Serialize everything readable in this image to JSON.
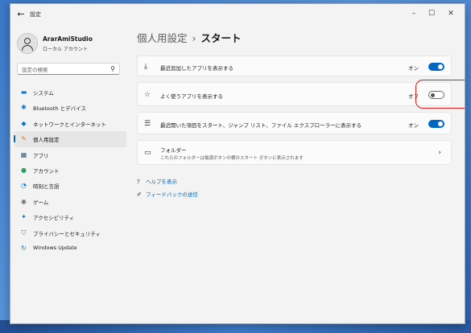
{
  "window": {
    "title": "設定",
    "back_glyph": "←",
    "min_glyph": "–",
    "max_glyph": "☐",
    "close_glyph": "✕"
  },
  "user": {
    "name": "ArarAmiStudio",
    "account_type": "ローカル アカウント"
  },
  "search": {
    "placeholder": "設定の検索",
    "icon": "search-icon",
    "glyph": "⚲"
  },
  "sidebar": {
    "items": [
      {
        "label": "システム",
        "icon": "monitor-icon",
        "glyph": "▬",
        "color": "#0078d4"
      },
      {
        "label": "Bluetooth とデバイス",
        "icon": "bluetooth-icon",
        "glyph": "✱",
        "color": "#0078d4"
      },
      {
        "label": "ネットワークとインターネット",
        "icon": "network-icon",
        "glyph": "◆",
        "color": "#0078d4"
      },
      {
        "label": "個人用設定",
        "icon": "brush-icon",
        "glyph": "✎",
        "color": "#d47a18",
        "active": true
      },
      {
        "label": "アプリ",
        "icon": "apps-icon",
        "glyph": "▦",
        "color": "#3c5a7a"
      },
      {
        "label": "アカウント",
        "icon": "account-icon",
        "glyph": "●",
        "color": "#2aa05a"
      },
      {
        "label": "時刻と言語",
        "icon": "globe-clock-icon",
        "glyph": "◔",
        "color": "#0078d4"
      },
      {
        "label": "ゲーム",
        "icon": "game-controller-icon",
        "glyph": "◉",
        "color": "#6b6b6b"
      },
      {
        "label": "アクセシビリティ",
        "icon": "accessibility-icon",
        "glyph": "✦",
        "color": "#0078d4"
      },
      {
        "label": "プライバシーとセキュリティ",
        "icon": "shield-icon",
        "glyph": "⛉",
        "color": "#6b6b6b"
      },
      {
        "label": "Windows Update",
        "icon": "update-icon",
        "glyph": "↻",
        "color": "#0078d4"
      }
    ]
  },
  "main": {
    "breadcrumb_parent": "個人用設定",
    "breadcrumb_sep": "›",
    "breadcrumb_current": "スタート",
    "settings": [
      {
        "label": "最近追加したアプリを表示する",
        "icon": "download-icon",
        "glyph": "⤓",
        "state": "オン",
        "on": true
      },
      {
        "label": "よく使うアプリを表示する",
        "icon": "star-icon",
        "glyph": "☆",
        "state": "オフ",
        "on": false
      },
      {
        "label": "最近開いた項目をスタート、ジャンプ リスト、ファイル エクスプローラーに表示する",
        "icon": "list-icon",
        "glyph": "☰",
        "state": "オン",
        "on": true
      }
    ],
    "folders": {
      "title": "フォルダー",
      "subtitle": "これらのフォルダーは電源ボタンの横のスタート ボタンに表示されます",
      "icon": "folder-icon",
      "glyph": "▭",
      "chevron": "›"
    },
    "links": [
      {
        "label": "ヘルプを表示",
        "icon": "help-icon",
        "glyph": "?"
      },
      {
        "label": "フィードバックの送信",
        "icon": "feedback-icon",
        "glyph": "✐"
      }
    ],
    "accent_color": "#0067c0",
    "highlight_color": "#e01c1c"
  }
}
